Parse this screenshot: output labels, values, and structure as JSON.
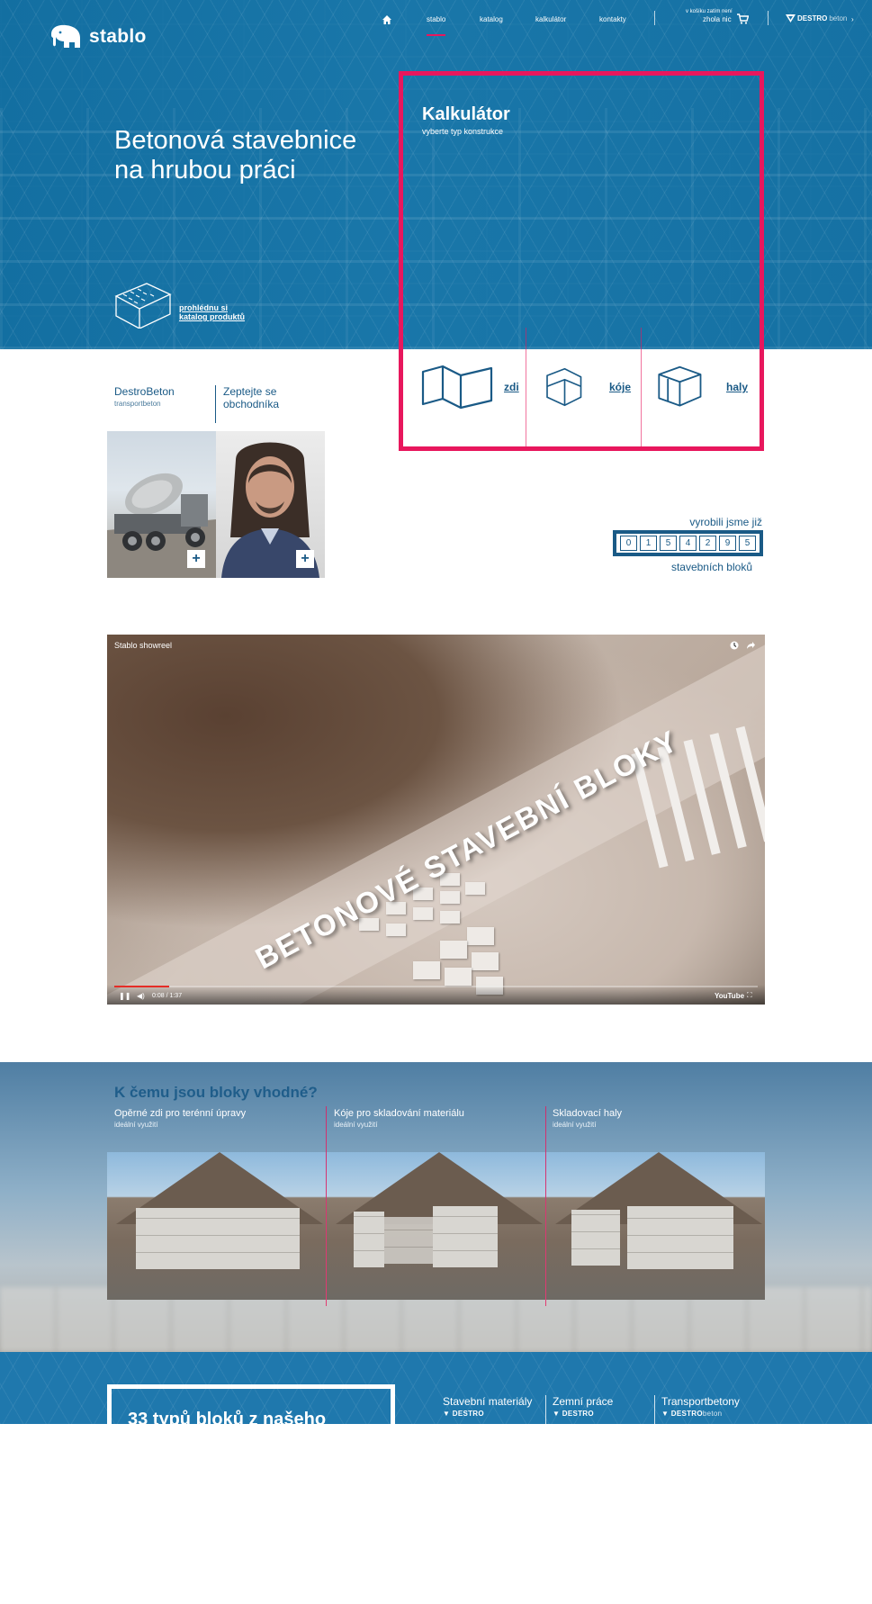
{
  "brand": {
    "name": "stablo"
  },
  "nav": {
    "items": [
      "stablo",
      "katalog",
      "kalkulátor",
      "kontakty"
    ],
    "active": "stablo",
    "cart_small": "v košíku zatím není",
    "cart_main": "zhola nic",
    "partner_bold": "DESTRO",
    "partner_light": "beton"
  },
  "hero": {
    "title_line1": "Betonová stavebnice",
    "title_line2": "na hrubou práci",
    "catalog_line1": "prohlédnu si",
    "catalog_line2": "katalog produktů"
  },
  "calculator": {
    "title": "Kalkulátor",
    "subtitle": "vyberte typ konstrukce",
    "options": [
      "zdi",
      "kóje",
      "haly"
    ],
    "accent_color": "#e8175d"
  },
  "contacts": {
    "tab1_title": "DestroBeton",
    "tab1_sub": "transportbeton",
    "tab2_line1": "Zeptejte se",
    "tab2_line2": "obchodníka",
    "plus": "+"
  },
  "counter": {
    "top": "vyrobili jsme již",
    "digits": [
      "0",
      "1",
      "5",
      "4",
      "2",
      "9",
      "5"
    ],
    "bottom": "stavebních bloků"
  },
  "video": {
    "title": "Stablo showreel",
    "overlay": "BETONOVÉ STAVEBNÍ BLOKY",
    "time": "0:08 / 1:37",
    "provider": "YouTube",
    "progress": 0.085
  },
  "uses": {
    "title": "K čemu jsou bloky vhodné?",
    "items": [
      {
        "title": "Opěrné zdi pro terénní úpravy",
        "sub": "ideální využití"
      },
      {
        "title": "Kóje pro skladování materiálu",
        "sub": "ideální využití"
      },
      {
        "title": "Skladovací haly",
        "sub": "ideální využití"
      }
    ]
  },
  "footer": {
    "box_text": "33 typů bloků z našeho",
    "partners": [
      {
        "name": "Stavební materiály",
        "logo_bold": "DESTRO",
        "logo_light": ""
      },
      {
        "name": "Zemní práce",
        "logo_bold": "DESTRO",
        "logo_light": ""
      },
      {
        "name": "Transportbetony",
        "logo_bold": "DESTRO",
        "logo_light": "beton"
      }
    ]
  },
  "colors": {
    "primary_blue": "#1a5a86",
    "hero_blue": "#1f78ad",
    "accent_pink": "#e8175d"
  }
}
